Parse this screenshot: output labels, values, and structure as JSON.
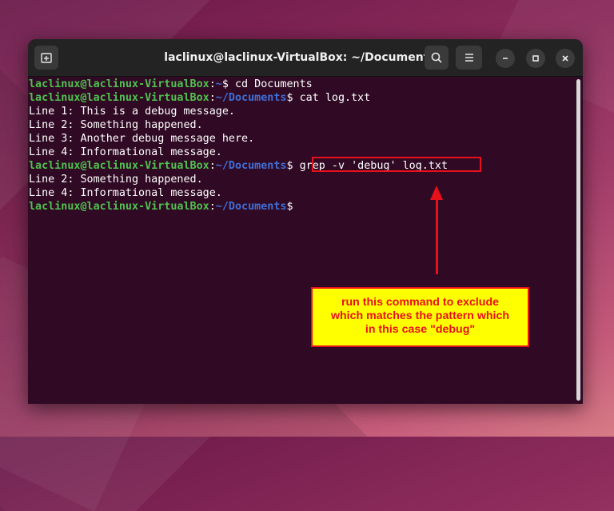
{
  "window": {
    "title": "laclinux@laclinux-VirtualBox: ~/Documents",
    "icons": {
      "new_tab": "new-tab-icon",
      "search": "search-icon",
      "menu": "hamburger-menu-icon",
      "minimize": "minimize-icon",
      "maximize": "maximize-icon",
      "close": "close-icon"
    }
  },
  "terminal": {
    "prompt_user": "laclinux@laclinux-VirtualBox",
    "prompt_colon": ":",
    "path_home": "~",
    "path_docs": "~/Documents",
    "prompt_symbol": "$",
    "commands": {
      "cd": " cd Documents",
      "cat": " cat log.txt",
      "grep": " grep -v 'debug' log.txt"
    },
    "cat_output": [
      "Line 1: This is a debug message.",
      "Line 2: Something happened.",
      "Line 3: Another debug message here.",
      "Line 4: Informational message."
    ],
    "grep_output": [
      "Line 2: Something happened.",
      "Line 4: Informational message."
    ]
  },
  "annotation": {
    "lines": [
      "run this command to exclude",
      "which matches the pattern which",
      "in this case \"debug\""
    ],
    "colors": {
      "border": "#e8101a",
      "fill": "#ffff00",
      "text": "#e8101a"
    }
  }
}
